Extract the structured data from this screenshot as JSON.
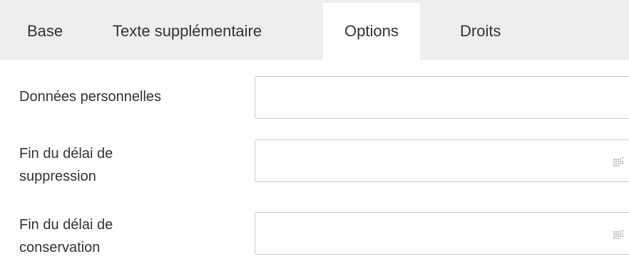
{
  "tabs": [
    {
      "label": "Base",
      "active": false
    },
    {
      "label": "Texte supplémentaire",
      "active": false
    },
    {
      "label": "Options",
      "active": true
    },
    {
      "label": "Droits",
      "active": false
    }
  ],
  "form": {
    "personal_data": {
      "label": "Données personnelles",
      "value": ""
    },
    "deletion_deadline": {
      "label_line1": "Fin du délai de",
      "label_line2": "suppression",
      "value": "",
      "icon": "calendar-grid-icon"
    },
    "retention_deadline": {
      "label_line1": "Fin du délai de",
      "label_line2": "conservation",
      "value": "",
      "icon": "calendar-grid-icon"
    }
  },
  "colors": {
    "tabbar_bg": "#eeeeee",
    "active_tab_bg": "#ffffff",
    "text": "#333333",
    "border": "#cccccc",
    "icon": "#bbbbbb"
  }
}
